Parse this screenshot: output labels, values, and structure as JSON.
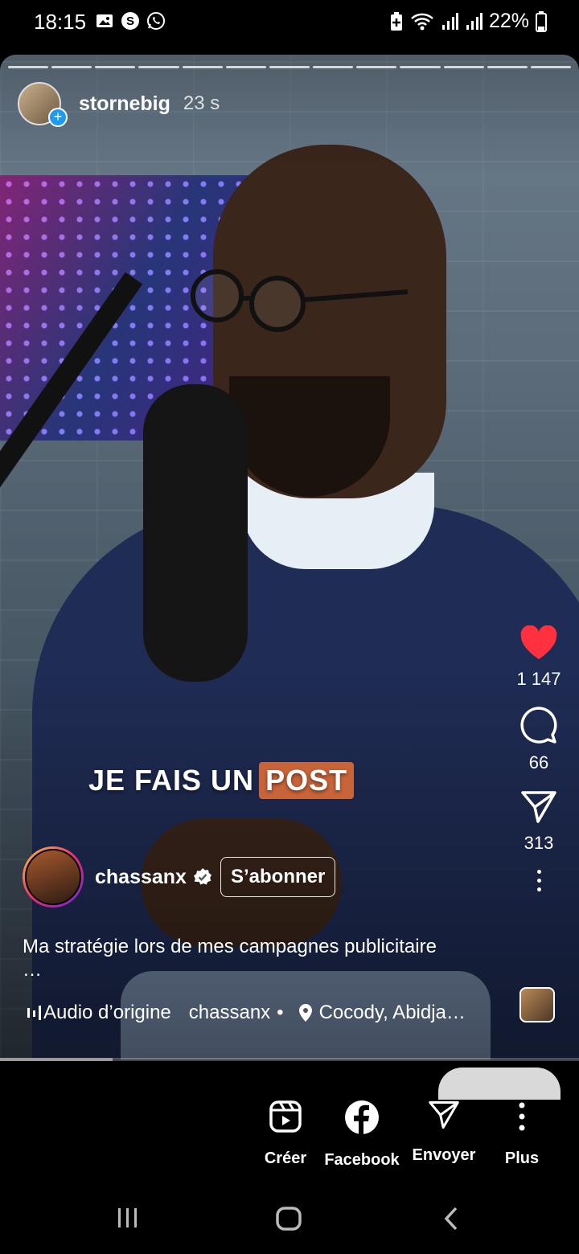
{
  "status_bar": {
    "time": "18:15",
    "battery": "22%",
    "left_icons": [
      "gallery-icon",
      "s-app-icon",
      "whatsapp-icon"
    ],
    "right_icons": [
      "battery-saver-icon",
      "wifi-icon",
      "signal-icon",
      "signal-icon",
      "battery-icon"
    ]
  },
  "story": {
    "username": "stornebig",
    "time_ago": "23 s",
    "segments": 13
  },
  "video_overlay": {
    "text": "JE FAIS UN",
    "highlight": "POST"
  },
  "actions": {
    "likes": "1 147",
    "comments": "66",
    "shares": "313"
  },
  "reel": {
    "author": "chassanx",
    "follow_label": "S’abonner",
    "caption": "Ma stratégie lors de mes campagnes publicitaire",
    "caption_more": "…",
    "audio_label": "Audio d’origine",
    "audio_author": "chassanx",
    "separator": "•",
    "location": "Cocody, Abidja…",
    "progress_percent": 19.5
  },
  "share_sheet": {
    "create_label": "Créer",
    "facebook_label": "Facebook",
    "send_label": "Envoyer",
    "more_label": "Plus"
  },
  "colors": {
    "like_red": "#ff3040",
    "highlight_orange": "#c8643a",
    "verified_blue": "#ffffff"
  }
}
